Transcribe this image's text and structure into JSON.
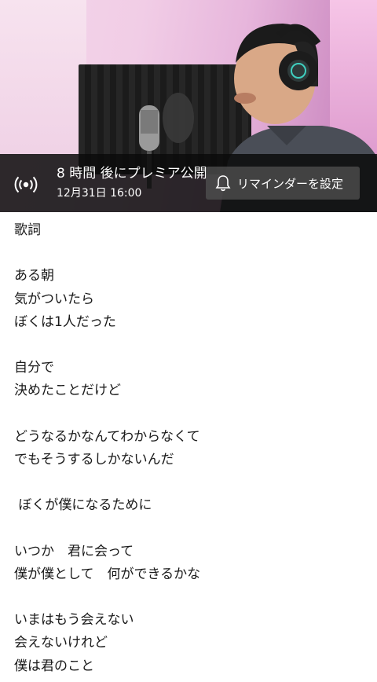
{
  "premiere": {
    "title": "8 時間 後にプレミア公開",
    "date": "12月31日 16:00"
  },
  "reminder": {
    "label": "リマインダーを設定",
    "icon": "bell-icon"
  },
  "live_icon": "broadcast-icon",
  "lyrics": {
    "heading": "歌詞",
    "lines": [
      "ある朝",
      "気がついたら",
      "ぼくは1人だった",
      "自分で",
      "決めたことだけど",
      "どうなるかなんてわからなくて",
      "でもそうするしかないんだ",
      " ぼくが僕になるために",
      "いつか　君に会って",
      "僕が僕として　何ができるかな",
      "いまはもう会えない",
      "会えないけれど",
      "僕は君のこと"
    ]
  }
}
